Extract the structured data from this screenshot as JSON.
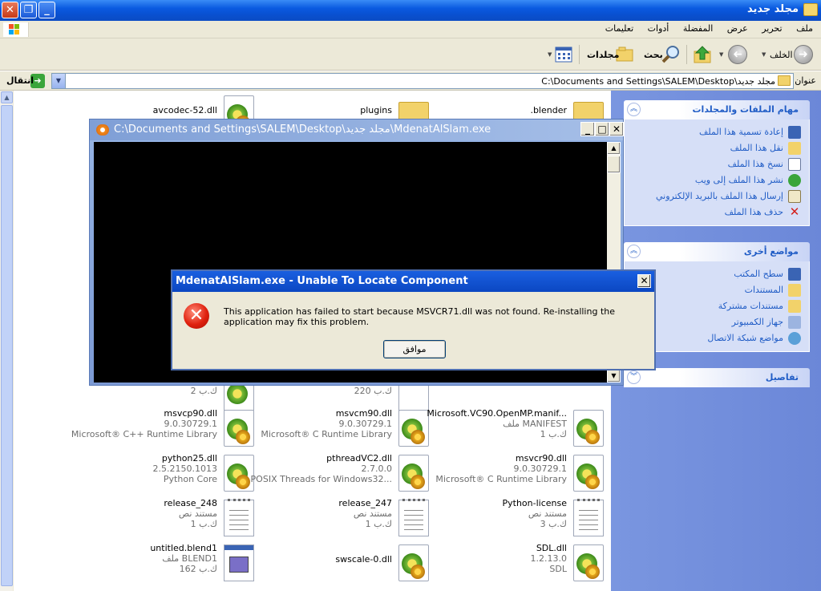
{
  "window": {
    "title": "مجلد جديد"
  },
  "menu": {
    "items": [
      "ملف",
      "تحرير",
      "عرض",
      "المفضلة",
      "أدوات",
      "تعليمات"
    ]
  },
  "toolbar": {
    "back": "الخلف",
    "search": "بحث",
    "folders": "مجلدات"
  },
  "address": {
    "label": "عنوان",
    "path": "C:\\Documents and Settings\\SALEM\\Desktop\\مجلد جديد",
    "go": "انتقال"
  },
  "files": [
    {
      "name": "avcodec-52.dll",
      "meta1": "",
      "meta2": "",
      "icon": "dll-icon"
    },
    {
      "name": "plugins",
      "meta1": "",
      "meta2": "",
      "icon": "folder-icon"
    },
    {
      "name": ".blender",
      "meta1": "",
      "meta2": "",
      "icon": "folder-icon"
    },
    {
      "name": "ك.ب 2",
      "meta1": "",
      "meta2": "",
      "icon": "dll-icon"
    },
    {
      "name": "ك.ب 220",
      "meta1": "",
      "meta2": "",
      "icon": "text-icon"
    },
    {
      "name": "msvcp90.dll",
      "meta1": "9.0.30729.1",
      "meta2": "Microsoft® C++ Runtime Library",
      "icon": "dll-icon"
    },
    {
      "name": "msvcm90.dll",
      "meta1": "9.0.30729.1",
      "meta2": "Microsoft® C Runtime Library",
      "icon": "dll-icon"
    },
    {
      "name": "Microsoft.VC90.OpenMP.manif...",
      "meta1": "ملف MANIFEST",
      "meta2": "ك.ب 1",
      "icon": "dll-icon"
    },
    {
      "name": "python25.dll",
      "meta1": "2.5.2150.1013",
      "meta2": "Python Core",
      "icon": "dll-icon"
    },
    {
      "name": "pthreadVC2.dll",
      "meta1": "2.7.0.0",
      "meta2": "POSIX Threads for Windows32...",
      "icon": "dll-icon"
    },
    {
      "name": "msvcr90.dll",
      "meta1": "9.0.30729.1",
      "meta2": "Microsoft® C Runtime Library",
      "icon": "dll-icon"
    },
    {
      "name": "release_248",
      "meta1": "مستند نص",
      "meta2": "ك.ب 1",
      "icon": "text-icon"
    },
    {
      "name": "release_247",
      "meta1": "مستند نص",
      "meta2": "ك.ب 1",
      "icon": "text-icon"
    },
    {
      "name": "Python-license",
      "meta1": "مستند نص",
      "meta2": "ك.ب 3",
      "icon": "text-icon"
    },
    {
      "name": "untitled.blend1",
      "meta1": "ملف BLEND1",
      "meta2": "ك.ب 162",
      "icon": "blend-icon"
    },
    {
      "name": "swscale-0.dll",
      "meta1": "",
      "meta2": "",
      "icon": "dll-icon"
    },
    {
      "name": "SDL.dll",
      "meta1": "1.2.13.0",
      "meta2": "SDL",
      "icon": "dll-icon"
    }
  ],
  "tasks": {
    "file_tasks": {
      "title": "مهام الملفات والمجلدات",
      "items": [
        "إعادة تسمية هذا الملف",
        "نقل هذا الملف",
        "نسخ هذا الملف",
        "نشر هذا الملف إلى ويب",
        "إرسال هذا الملف بالبريد الإلكتروني",
        "حذف هذا الملف"
      ]
    },
    "other_places": {
      "title": "مواضع أخرى",
      "items": [
        "سطح المكتب",
        "المستندات",
        "مستندات مشتركة",
        "جهاز الكمبيوتر",
        "مواضع شبكة الاتصال"
      ]
    },
    "details": {
      "title": "تفاصيل"
    }
  },
  "console": {
    "title": "C:\\Documents and Settings\\SALEM\\Desktop\\مجلد جديد\\MdenatAlSlam.exe"
  },
  "dialog": {
    "title": "MdenatAlSlam.exe - Unable To Locate Component",
    "message": "This application has failed to start because MSVCR71.dll was not found. Re-installing the application may fix this problem.",
    "ok": "موافق"
  },
  "colors": {
    "xp_blue": "#0a5ae0",
    "task_pane": "#7a96e0",
    "link": "#215dc6",
    "error_red": "#e0210e"
  }
}
